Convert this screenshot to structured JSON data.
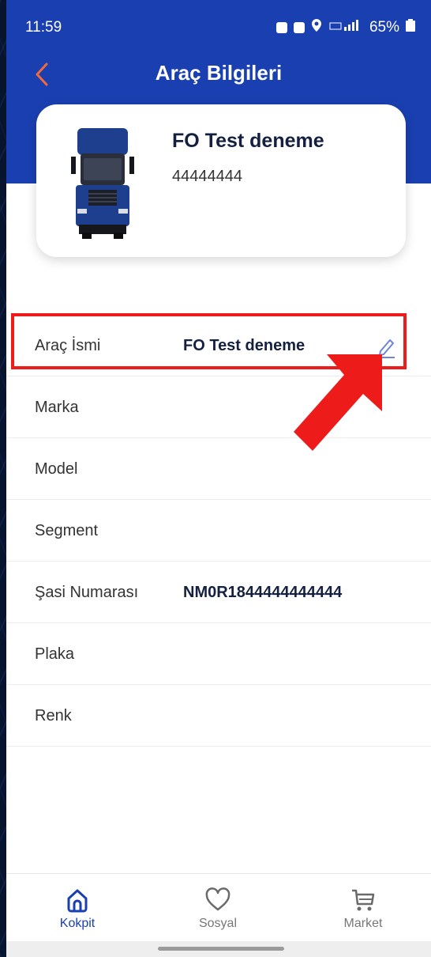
{
  "status_bar": {
    "time": "11:59",
    "battery": "65%"
  },
  "header": {
    "title": "Araç Bilgileri"
  },
  "vehicle": {
    "name": "FO Test deneme",
    "plate": "44444444"
  },
  "rows": [
    {
      "label": "Araç İsmi",
      "value": "FO Test deneme"
    },
    {
      "label": "Marka",
      "value": ""
    },
    {
      "label": "Model",
      "value": ""
    },
    {
      "label": "Segment",
      "value": ""
    },
    {
      "label": "Şasi Numarası",
      "value": "NM0R1844444444444"
    },
    {
      "label": "Plaka",
      "value": ""
    },
    {
      "label": "Renk",
      "value": ""
    }
  ],
  "tabs": [
    {
      "label": "Kokpit",
      "icon": "home-icon",
      "active": true
    },
    {
      "label": "Sosyal",
      "icon": "heart-icon",
      "active": false
    },
    {
      "label": "Market",
      "icon": "cart-icon",
      "active": false
    }
  ],
  "colors": {
    "header_blue": "#1a3fb0",
    "accent_orange": "#f06a3c",
    "highlight_red": "#ee1b1b",
    "edit_icon": "#6c84e0"
  }
}
